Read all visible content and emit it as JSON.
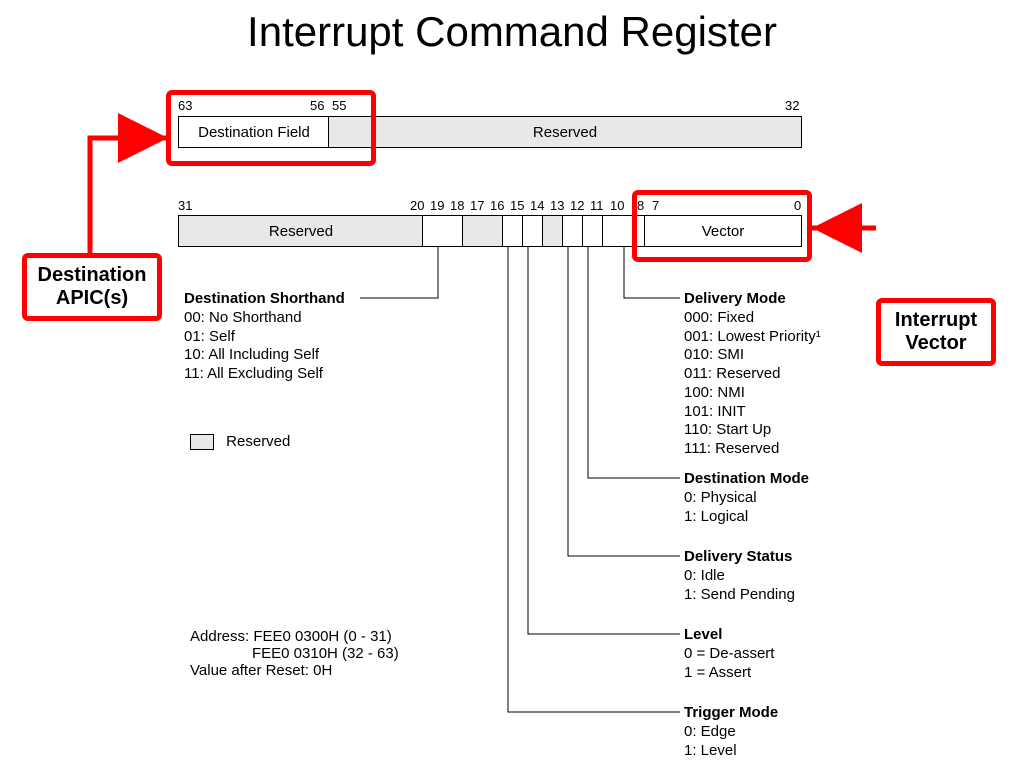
{
  "title": "Interrupt Command Register",
  "upper_row": {
    "bit_left": "63",
    "bit_mid_l": "56",
    "bit_mid_r": "55",
    "bit_right": "32",
    "dest_field": "Destination Field",
    "reserved": "Reserved"
  },
  "lower_row": {
    "bit_31": "31",
    "bit_20": "20",
    "bit_19": "19",
    "bit_18": "18",
    "bit_17": "17",
    "bit_16": "16",
    "bit_15": "15",
    "bit_14": "14",
    "bit_13": "13",
    "bit_12": "12",
    "bit_11": "11",
    "bit_10": "10",
    "bit_8": "8",
    "bit_7": "7",
    "bit_0": "0",
    "reserved": "Reserved",
    "vector": "Vector"
  },
  "callouts": {
    "dest_apic": "Destination\nAPIC(s)",
    "int_vector": "Interrupt\nVector"
  },
  "descs": {
    "dest_short": {
      "hd": "Destination Shorthand",
      "lines": [
        "00: No Shorthand",
        "01: Self",
        "10: All Including Self",
        "11: All Excluding Self"
      ]
    },
    "delivery_mode": {
      "hd": "Delivery Mode",
      "lines": [
        "000: Fixed",
        "001: Lowest Priority¹",
        "010: SMI",
        "011: Reserved",
        "100: NMI",
        "101: INIT",
        "110: Start Up",
        "111: Reserved"
      ]
    },
    "dest_mode": {
      "hd": "Destination Mode",
      "lines": [
        "0: Physical",
        "1: Logical"
      ]
    },
    "delivery_status": {
      "hd": "Delivery Status",
      "lines": [
        "0: Idle",
        "1: Send Pending"
      ]
    },
    "level": {
      "hd": "Level",
      "lines": [
        "0 = De-assert",
        "1 = Assert"
      ]
    },
    "trigger_mode": {
      "hd": "Trigger Mode",
      "lines": [
        "0: Edge",
        "1: Level"
      ]
    }
  },
  "legend": "Reserved",
  "addr": {
    "l1": "Address: FEE0 0300H (0 - 31)",
    "l2": "FEE0 0310H (32 - 63)",
    "l3": "Value after Reset: 0H"
  },
  "chart_data": {
    "type": "table",
    "title": "Interrupt Command Register bitfield layout",
    "fields": [
      {
        "name": "Destination Field",
        "bits": "63:56",
        "reserved": false
      },
      {
        "name": "Reserved",
        "bits": "55:32",
        "reserved": true
      },
      {
        "name": "Reserved",
        "bits": "31:20",
        "reserved": true
      },
      {
        "name": "Destination Shorthand",
        "bits": "19:18",
        "reserved": false,
        "values": {
          "00": "No Shorthand",
          "01": "Self",
          "10": "All Including Self",
          "11": "All Excluding Self"
        }
      },
      {
        "name": "Reserved",
        "bits": "17:16",
        "reserved": true
      },
      {
        "name": "Trigger Mode",
        "bits": "15",
        "reserved": false,
        "values": {
          "0": "Edge",
          "1": "Level"
        }
      },
      {
        "name": "Level",
        "bits": "14",
        "reserved": false,
        "values": {
          "0": "De-assert",
          "1": "Assert"
        }
      },
      {
        "name": "Reserved",
        "bits": "13",
        "reserved": true
      },
      {
        "name": "Delivery Status",
        "bits": "12",
        "reserved": false,
        "values": {
          "0": "Idle",
          "1": "Send Pending"
        }
      },
      {
        "name": "Destination Mode",
        "bits": "11",
        "reserved": false,
        "values": {
          "0": "Physical",
          "1": "Logical"
        }
      },
      {
        "name": "Delivery Mode",
        "bits": "10:8",
        "reserved": false,
        "values": {
          "000": "Fixed",
          "001": "Lowest Priority",
          "010": "SMI",
          "011": "Reserved",
          "100": "NMI",
          "101": "INIT",
          "110": "Start Up",
          "111": "Reserved"
        }
      },
      {
        "name": "Vector",
        "bits": "7:0",
        "reserved": false
      }
    ],
    "address_low": "FEE0 0300H (0 - 31)",
    "address_high": "FEE0 0310H (32 - 63)",
    "reset_value": "0H"
  }
}
